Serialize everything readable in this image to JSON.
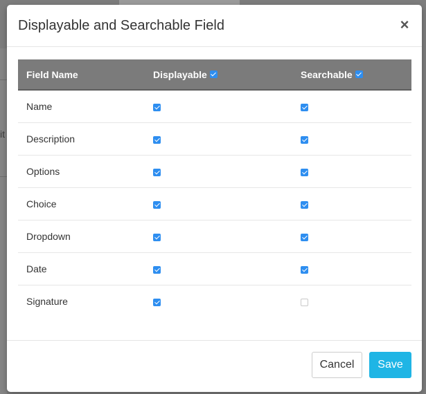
{
  "background": {
    "partial_text": "it"
  },
  "modal": {
    "title": "Displayable and Searchable Field",
    "close_symbol": "×"
  },
  "table": {
    "headers": {
      "field_name": "Field Name",
      "displayable": "Displayable",
      "searchable": "Searchable"
    },
    "header_checks": {
      "displayable": true,
      "searchable": true
    },
    "rows": [
      {
        "name": "Name",
        "displayable": true,
        "searchable": true
      },
      {
        "name": "Description",
        "displayable": true,
        "searchable": true
      },
      {
        "name": "Options",
        "displayable": true,
        "searchable": true
      },
      {
        "name": "Choice",
        "displayable": true,
        "searchable": true
      },
      {
        "name": "Dropdown",
        "displayable": true,
        "searchable": true
      },
      {
        "name": "Date",
        "displayable": true,
        "searchable": true
      },
      {
        "name": "Signature",
        "displayable": true,
        "searchable": false
      }
    ]
  },
  "footer": {
    "cancel_label": "Cancel",
    "save_label": "Save"
  },
  "colors": {
    "header_bg": "#7b7b7b",
    "checkbox_on": "#2e8ef0",
    "save_button": "#1fb5e5"
  }
}
